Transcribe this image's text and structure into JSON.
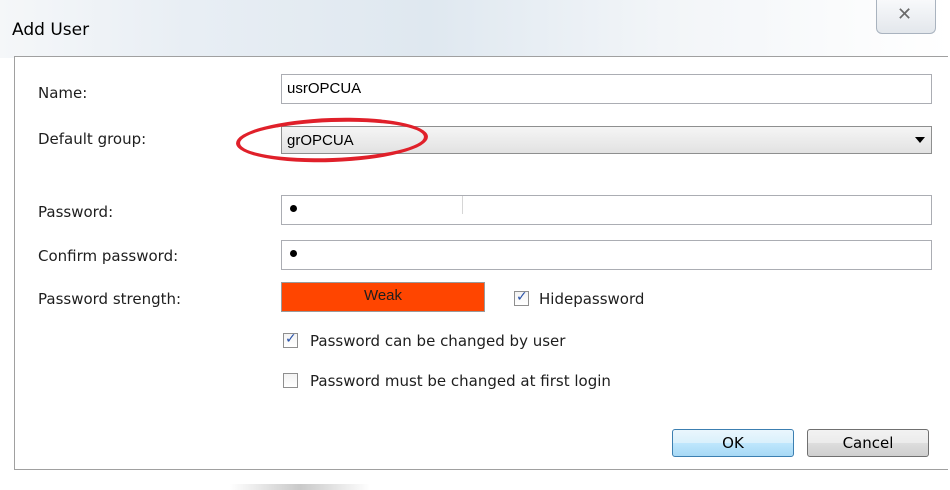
{
  "window": {
    "title": "Add User",
    "close_glyph": "☒"
  },
  "form": {
    "name_label": "Name:",
    "name_value": "usrOPCUA",
    "group_label": "Default group:",
    "group_value": "grOPCUA",
    "password_label": "Password:",
    "confirm_label": "Confirm password:",
    "strength_label": "Password strength:",
    "strength_value": "Weak",
    "strength_color": "#ff4500",
    "hide_password_label": "Hidepassword",
    "hide_password_checked": true,
    "can_change_label": "Password can be changed by user",
    "can_change_checked": true,
    "must_change_label": "Password must be changed at first login",
    "must_change_checked": false
  },
  "buttons": {
    "ok_label": "OK",
    "cancel_label": "Cancel"
  },
  "annotation": {
    "highlight_color": "#e0202a"
  }
}
